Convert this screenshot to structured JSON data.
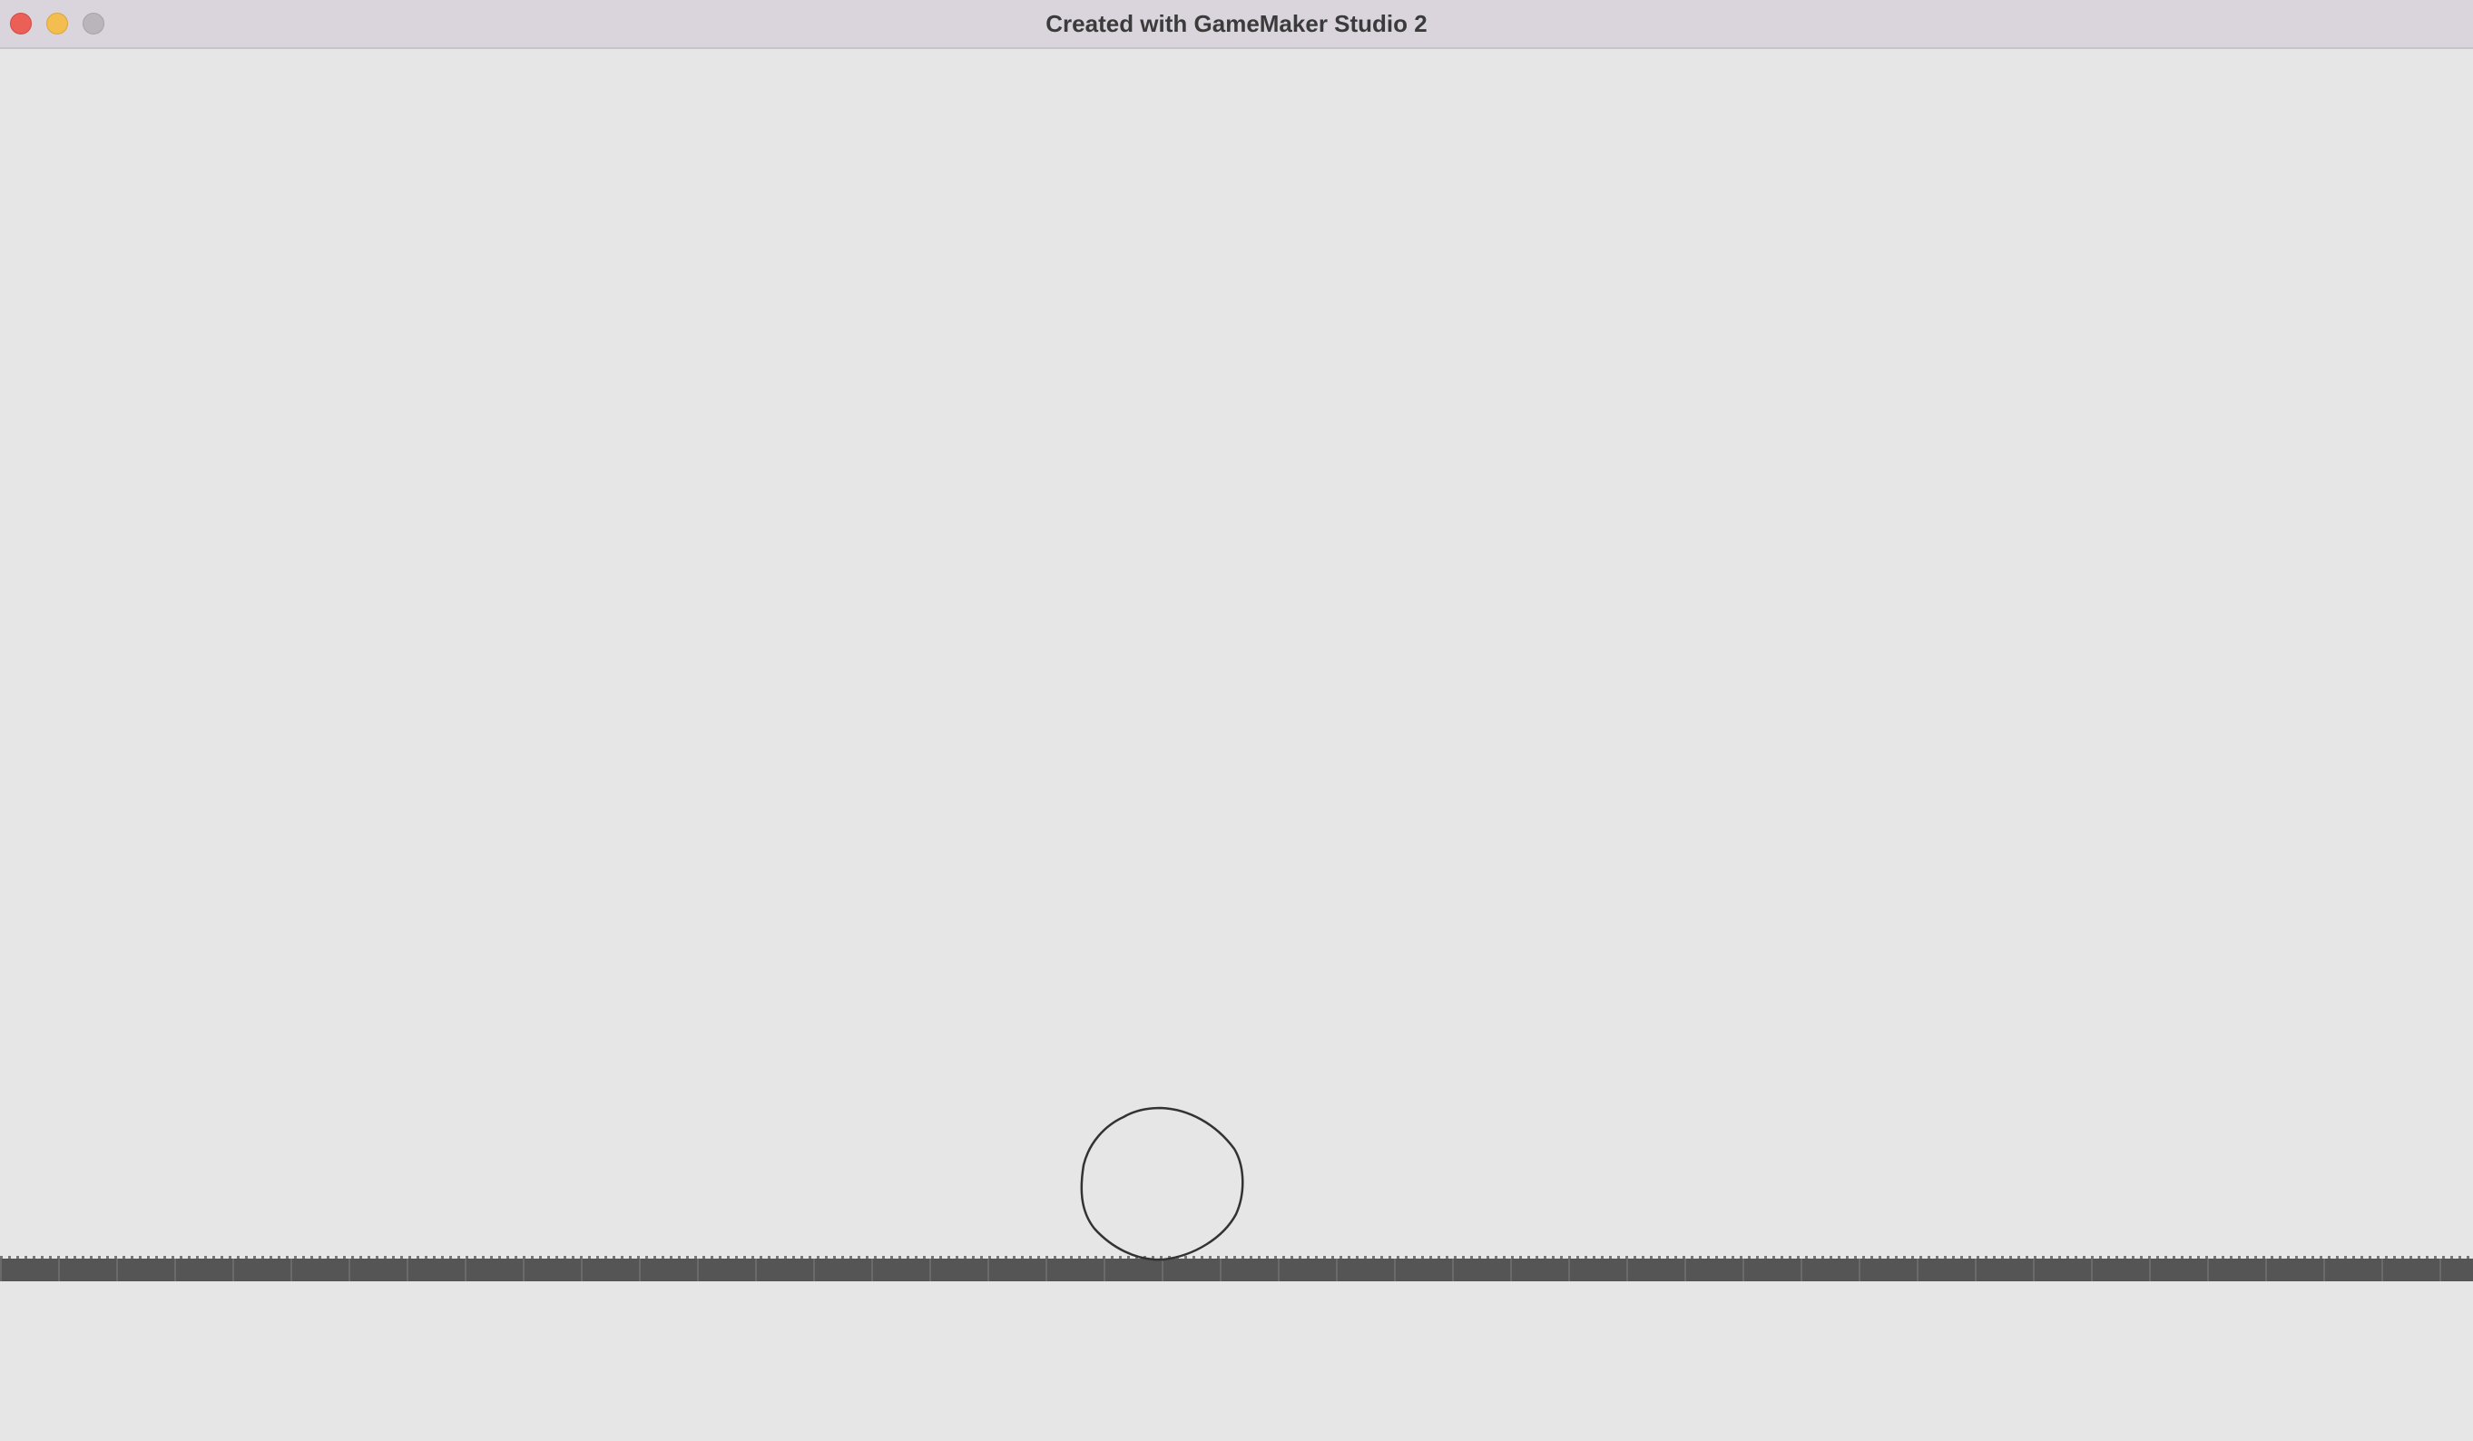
{
  "window": {
    "title": "Created with GameMaker Studio 2"
  },
  "controls": {
    "close_icon": "close-icon",
    "minimize_icon": "minimize-icon",
    "zoom_icon": "zoom-icon"
  },
  "colors": {
    "background": "#e6e6e6",
    "titlebar": "#dad5dc",
    "ground": "#555555",
    "ball_outline": "#333333"
  },
  "scene": {
    "ball": "hand-drawn circle sprite",
    "ground": "textured floor strip"
  }
}
